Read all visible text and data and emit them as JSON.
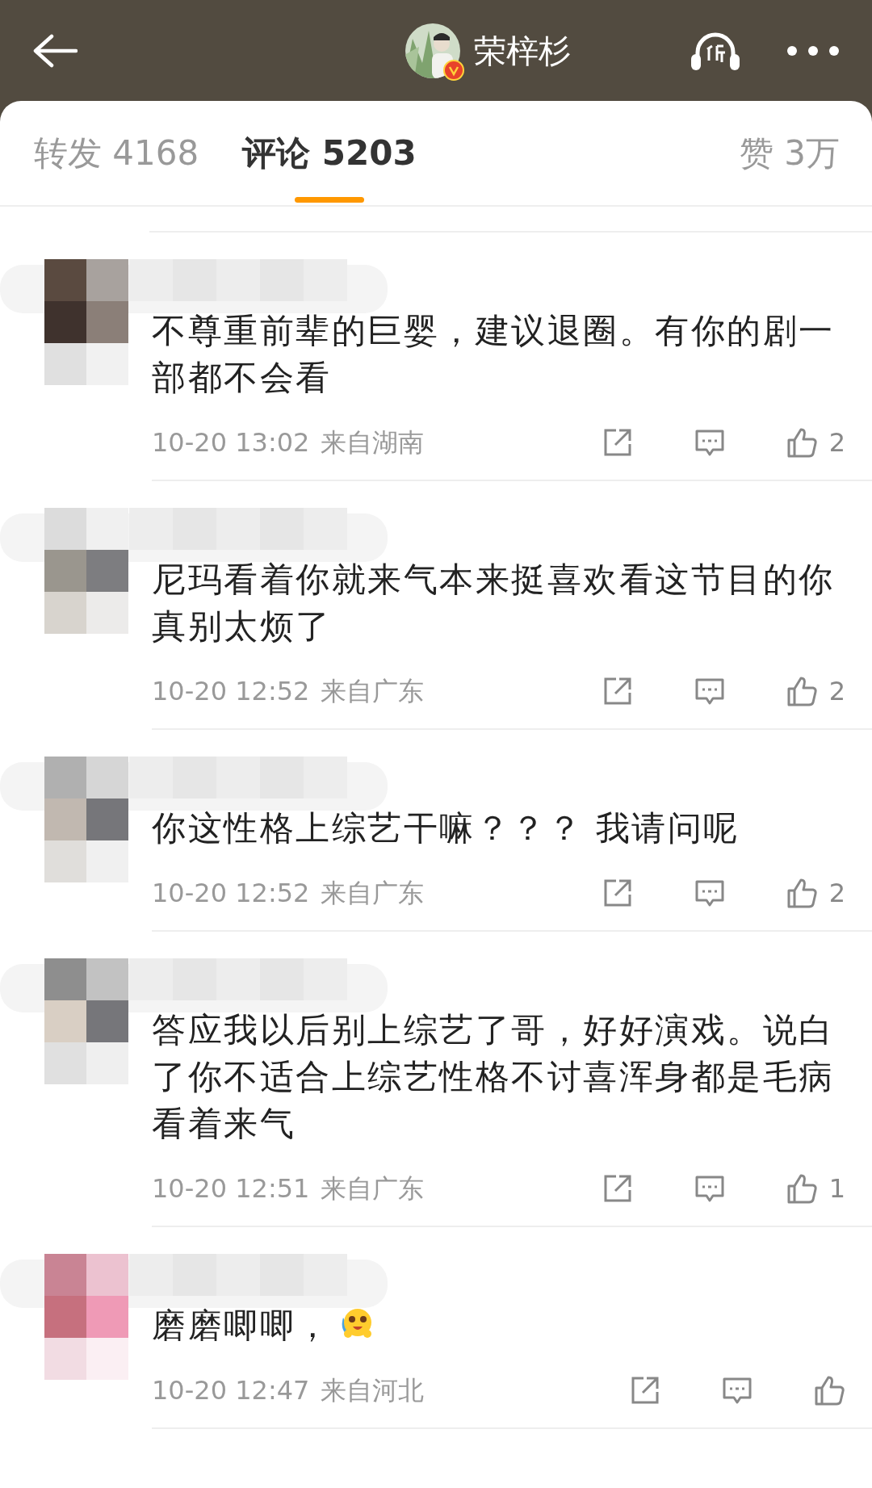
{
  "header": {
    "title": "荣梓杉",
    "avatar": {
      "kind": "picture",
      "verified": true
    }
  },
  "tabs": [
    {
      "label": "转发",
      "count": "4168",
      "selected": false
    },
    {
      "label": "评论",
      "count": "5203",
      "selected": true
    },
    {
      "label": "赞",
      "count": "3万",
      "selected": false
    }
  ],
  "comments": [
    {
      "text": "不尊重前辈的巨婴，建议退圈。有你的剧一部都不会看",
      "emoji": false,
      "time": "10-20 13:02",
      "location": "来自湖南",
      "likes": "2"
    },
    {
      "text": "尼玛看着你就来气本来挺喜欢看这节目的你真别太烦了",
      "emoji": false,
      "time": "10-20 12:52",
      "location": "来自广东",
      "likes": "2"
    },
    {
      "text": "你这性格上综艺干嘛？？？ 我请问呢",
      "emoji": false,
      "time": "10-20 12:52",
      "location": "来自广东",
      "likes": "2"
    },
    {
      "text": "答应我以后别上综艺了哥，好好演戏。说白了你不适合上综艺性格不讨喜浑身都是毛病看着来气",
      "emoji": false,
      "time": "10-20 12:51",
      "location": "来自广东",
      "likes": "1"
    },
    {
      "text": "磨磨唧唧，",
      "emoji": true,
      "time": "10-20 12:47",
      "location": "来自河北"
    }
  ]
}
